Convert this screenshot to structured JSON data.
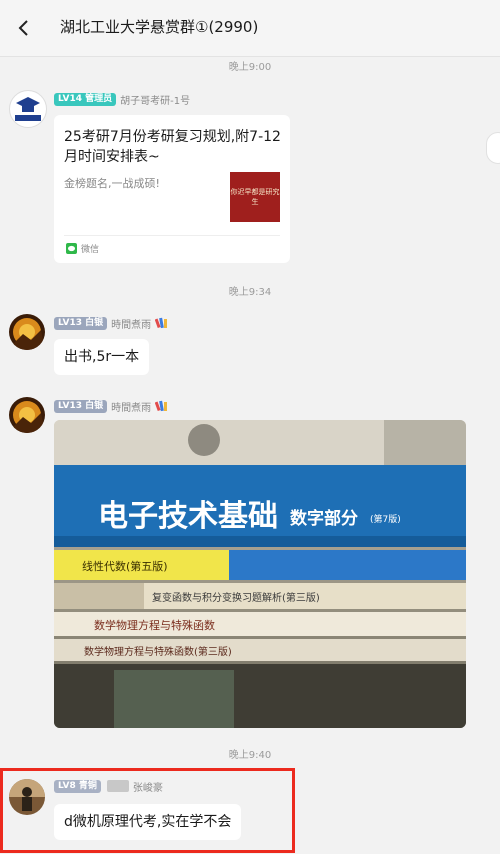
{
  "header": {
    "title": "湖北工业大学悬赏群①(2990)"
  },
  "messages": {
    "time1": "晚上9:00",
    "msg1": {
      "badge": "LV14 管理员",
      "nickname": "胡子哥考研-1号",
      "avatar_label": "胡子哥考研",
      "card_title": "25考研7月份考研复习规划,附7-12月时间安排表~",
      "card_desc": "金榜题名,一战成硕!",
      "card_thumb_text": "你迟早都是研究生",
      "card_source": "微信"
    },
    "time2": "晚上9:34",
    "msg2": {
      "badge": "LV13 白银",
      "nickname": "時間煮雨",
      "text": "出书,5r一本"
    },
    "msg3": {
      "badge": "LV13 白银",
      "nickname": "時間煮雨",
      "photo_labels": {
        "book1_title": "电子技术基础",
        "book1_sub": "数字部分",
        "book1_edition": "(第7版)",
        "book2": "线性代数(第五版)",
        "book3": "复变函数与积分变换习题解析(第三版)",
        "book4": "数学物理方程与特殊函数",
        "book5": "数学物理方程与特殊函数(第三版)"
      }
    },
    "time3": "晚上9:40",
    "msg4": {
      "badge": "LV8 青铜",
      "nickname": "张峻豪",
      "text": "d微机原理代考,实在学不会"
    }
  },
  "colors": {
    "highlight": "#ec2a1e",
    "admin_badge": "#39c7bd",
    "silver_badge": "#9ba6bc"
  },
  "icons": [
    "back-arrow-icon",
    "wechat-icon",
    "crayon-emoji-icon"
  ]
}
